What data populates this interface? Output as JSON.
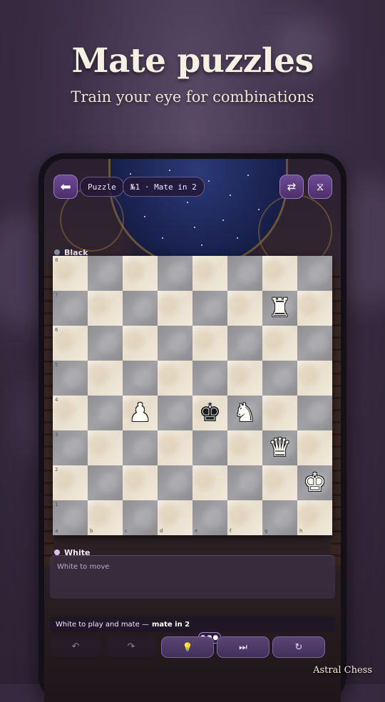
{
  "headline": "Mate puzzles",
  "subheadline": "Train your eye for combinations",
  "topbar": {
    "back_icon": "arrow-left-icon",
    "mode_label": "Puzzle",
    "puzzle_label": "№1 · Mate in 2",
    "flip_icon": "swap-icon",
    "theme_icon": "hourglass-icon"
  },
  "players": {
    "top": "Black",
    "bottom": "White",
    "top_dot_color": "#8b8fa8",
    "bottom_dot_color": "#d7c4f2"
  },
  "board": {
    "ranks": [
      "8",
      "7",
      "6",
      "5",
      "4",
      "3",
      "2",
      "1"
    ],
    "files": [
      "a",
      "b",
      "c",
      "d",
      "e",
      "f",
      "g",
      "h"
    ],
    "pieces": [
      {
        "square": "g7",
        "piece": "white-rook",
        "glyph": "♜",
        "color": "w"
      },
      {
        "square": "c4",
        "piece": "white-pawn",
        "glyph": "♟",
        "color": "w"
      },
      {
        "square": "e4",
        "piece": "black-king",
        "glyph": "♚",
        "color": "b"
      },
      {
        "square": "f4",
        "piece": "white-knight",
        "glyph": "♞",
        "color": "w"
      },
      {
        "square": "g3",
        "piece": "white-queen",
        "glyph": "♛",
        "color": "w"
      },
      {
        "square": "h2",
        "piece": "white-king",
        "glyph": "♚",
        "color": "w"
      }
    ]
  },
  "moves_placeholder": "White to move",
  "status": {
    "prefix": "White to play and mate —",
    "emphasis": "mate in 2"
  },
  "more_label": "●●●",
  "controls": [
    {
      "name": "undo",
      "glyph": "↶",
      "icon": "undo-icon",
      "enabled": false
    },
    {
      "name": "redo",
      "glyph": "↷",
      "icon": "redo-icon",
      "enabled": false
    },
    {
      "name": "hint",
      "glyph": "💡",
      "icon": "lightbulb-icon",
      "enabled": true
    },
    {
      "name": "skip",
      "glyph": "⏭",
      "icon": "skip-forward-icon",
      "enabled": true
    },
    {
      "name": "restart",
      "glyph": "↻",
      "icon": "restart-icon",
      "enabled": true
    }
  ],
  "brand": "Astral Chess"
}
